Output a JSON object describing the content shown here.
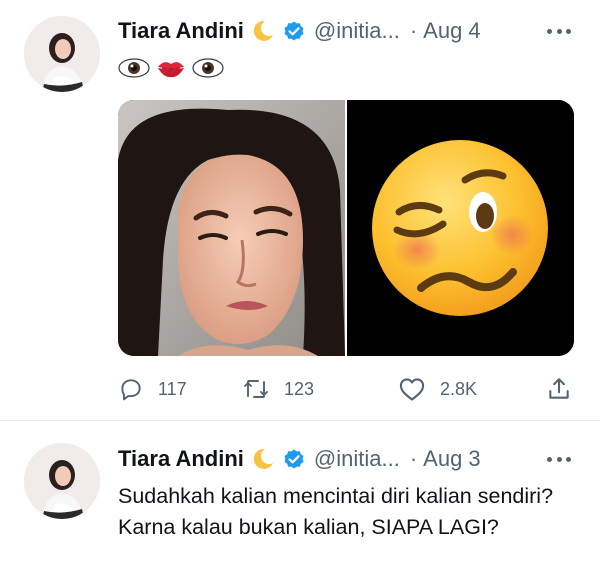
{
  "tweets": [
    {
      "author_name": "Tiara Andini",
      "handle": "@initia...",
      "separator": "·",
      "date": "Aug 4",
      "text_emojis": [
        "eyes-emoji",
        "lips-emoji",
        "eyes-emoji"
      ],
      "media": [
        {
          "kind": "photo",
          "description_icon": "woman-grimacing-photo"
        },
        {
          "kind": "emoji",
          "description_icon": "woozy-face-emoji"
        }
      ],
      "stats": {
        "replies": "117",
        "retweets": "123",
        "likes": "2.8K"
      }
    },
    {
      "author_name": "Tiara Andini",
      "handle": "@initia...",
      "separator": "·",
      "date": "Aug 3",
      "text": "Sudahkah kalian mencintai diri kalian sendiri? Karna kalau bukan kalian, SIAPA LAGI?"
    }
  ],
  "colors": {
    "text_primary": "#0f1419",
    "text_secondary": "#536471",
    "verified_blue": "#1d9bf0",
    "divider": "#e6ecf0"
  }
}
